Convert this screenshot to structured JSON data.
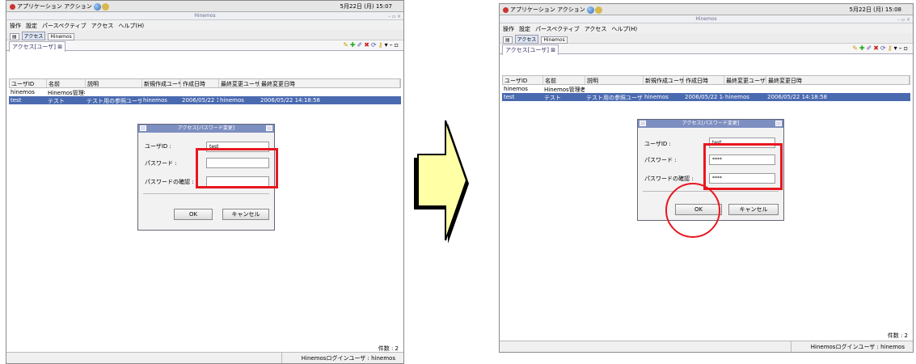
{
  "before": {
    "sysbar": {
      "menu": "アプリケーション アクション",
      "clock": "5月22日 (月) 15:07"
    },
    "window_title": "Hinemos",
    "menubar": [
      "操作",
      "設定",
      "パースペクティブ",
      "アクセス",
      "ヘルプ(H)"
    ],
    "perspectives": [
      "アクセス",
      "Hinemos"
    ],
    "view_tab": "アクセス[ユーザ]",
    "columns": [
      "ユーザID",
      "名前",
      "説明",
      "新規作成ユーザ",
      "作成日時",
      "最終変更ユーザ",
      "最終変更日時"
    ],
    "rows": [
      [
        "hinemos",
        "Hinemos管理者",
        "",
        "",
        "",
        "",
        ""
      ],
      [
        "test",
        "テスト",
        "テスト用の参照ユーザ",
        "hinemos",
        "2006/05/22 14:",
        "hinemos",
        "2006/05/22 14:18:58"
      ]
    ],
    "count": "件数 : 2",
    "status_user": "Hinemosログインユーザ : hinemos",
    "dialog": {
      "title": "アクセス[パスワード変更]",
      "user_label": "ユーザID :",
      "user_value": "test",
      "password_label": "パスワード :",
      "password_value": "",
      "confirm_label": "パスワードの確認 :",
      "confirm_value": "",
      "ok": "OK",
      "cancel": "キャンセル"
    }
  },
  "after": {
    "sysbar": {
      "menu": "アプリケーション アクション",
      "clock": "5月22日 (月) 15:08"
    },
    "window_title": "Hinemos",
    "menubar": [
      "操作",
      "設定",
      "パースペクティブ",
      "アクセス",
      "ヘルプ(H)"
    ],
    "perspectives": [
      "アクセス",
      "Hinemos"
    ],
    "view_tab": "アクセス[ユーザ]",
    "columns": [
      "ユーザID",
      "名前",
      "説明",
      "新規作成ユーザ",
      "作成日時",
      "最終変更ユーザ",
      "最終変更日時"
    ],
    "rows": [
      [
        "hinemos",
        "Hinemos管理者",
        "",
        "",
        "",
        "",
        ""
      ],
      [
        "test",
        "テスト",
        "テスト用の参照ユーザ",
        "hinemos",
        "2006/05/22 14:",
        "hinemos",
        "2006/05/22 14:18:58"
      ]
    ],
    "count": "件数 : 2",
    "status_user": "Hinemosログインユーザ : hinemos",
    "dialog": {
      "title": "アクセス[パスワード変更]",
      "user_label": "ユーザID :",
      "user_value": "test",
      "password_label": "パスワード :",
      "password_value": "****",
      "confirm_label": "パスワードの確認 :",
      "confirm_value": "****",
      "ok": "OK",
      "cancel": "キャンセル"
    }
  },
  "colors": {
    "highlight": "#e8171f",
    "arrow_fill": "#ffffa6",
    "selection": "#4a6ab0"
  }
}
